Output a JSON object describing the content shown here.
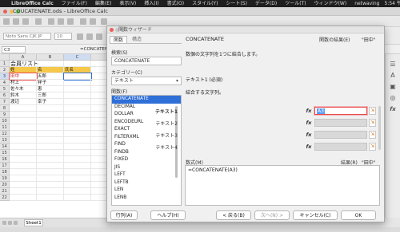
{
  "menubar": {
    "app": "LibreOffice Calc",
    "items": [
      "ファイル(F)",
      "編集(E)",
      "表示(V)",
      "挿入(I)",
      "書式(O)",
      "スタイル(Y)",
      "シート(S)",
      "データ(D)",
      "ツール(T)",
      "ウィンドウ(W)"
    ],
    "right_user": "netwaving",
    "right_time": "5:54 午後"
  },
  "window": {
    "title": "COUCATENATE.ods - LibreOffice Calc"
  },
  "toolbar": {
    "font_name": "Noto Sans CJK JP",
    "font_size": "10"
  },
  "formula_bar": {
    "name_box": "C3",
    "content": "=CONCATENATE(A3)"
  },
  "sheet": {
    "columns": [
      "A",
      "B",
      "C"
    ],
    "rows": [
      {
        "num": "1",
        "a": "会員リスト",
        "b": "",
        "c": ""
      },
      {
        "num": "2",
        "a": "姓",
        "b": "名",
        "c": "氏名"
      },
      {
        "num": "3",
        "a": "田中",
        "b": "五郎",
        "c": ""
      },
      {
        "num": "4",
        "a": "村上",
        "b": "祥子",
        "c": ""
      },
      {
        "num": "5",
        "a": "佐々木",
        "b": "恵",
        "c": ""
      },
      {
        "num": "6",
        "a": "鈴木",
        "b": "三郎",
        "c": ""
      },
      {
        "num": "7",
        "a": "渡辺",
        "b": "幸子",
        "c": ""
      },
      {
        "num": "8",
        "a": "",
        "b": "",
        "c": ""
      },
      {
        "num": "9",
        "a": "",
        "b": "",
        "c": ""
      },
      {
        "num": "10",
        "a": "",
        "b": "",
        "c": ""
      },
      {
        "num": "11",
        "a": "",
        "b": "",
        "c": ""
      },
      {
        "num": "12",
        "a": "",
        "b": "",
        "c": ""
      },
      {
        "num": "13",
        "a": "",
        "b": "",
        "c": ""
      },
      {
        "num": "14",
        "a": "",
        "b": "",
        "c": ""
      },
      {
        "num": "15",
        "a": "",
        "b": "",
        "c": ""
      },
      {
        "num": "16",
        "a": "",
        "b": "",
        "c": ""
      },
      {
        "num": "17",
        "a": "",
        "b": "",
        "c": ""
      },
      {
        "num": "18",
        "a": "",
        "b": "",
        "c": ""
      },
      {
        "num": "19",
        "a": "",
        "b": "",
        "c": ""
      },
      {
        "num": "20",
        "a": "",
        "b": "",
        "c": ""
      },
      {
        "num": "21",
        "a": "",
        "b": "",
        "c": ""
      },
      {
        "num": "22",
        "a": "",
        "b": "",
        "c": ""
      }
    ],
    "tab": "Sheet1"
  },
  "wizard": {
    "title": "関数ウィザード",
    "tabs": {
      "functions": "関数",
      "structure": "構造"
    },
    "search_label": "検索(S)",
    "search_value": "CONCATENATE",
    "category_label": "カテゴリー(C)",
    "category_value": "テキスト",
    "function_label": "関数(F)",
    "functions": [
      "CONCATENATE",
      "DECIMAL",
      "DOLLAR",
      "ENCODEURL",
      "EXACT",
      "FILTERXML",
      "FIND",
      "FINDB",
      "FIXED",
      "JIS",
      "LEFT",
      "LEFTB",
      "LEN",
      "LENB"
    ],
    "selected_function": "CONCATENATE",
    "fn_name": "CONCATENATE",
    "result_label": "関数の結果(E)",
    "result_value": "\"田中\"",
    "fn_description": "数個の文字列を1つに結合します。",
    "arg_name": "テキスト1 (必須)",
    "arg_description": "結合する文字列。",
    "args": [
      {
        "label": "テキスト1",
        "value": "A3",
        "active": true
      },
      {
        "label": "テキスト2",
        "value": "",
        "active": false
      },
      {
        "label": "テキスト3",
        "value": "",
        "active": false
      },
      {
        "label": "テキスト4",
        "value": "",
        "active": false
      }
    ],
    "fx_glyph": "fx",
    "shrink_glyph": "⇲",
    "formula_label": "数式(M)",
    "formula_value": "=CONCATENATE(A3)",
    "result2_label": "結果(R)",
    "result2_value": "\"田中\"",
    "buttons": {
      "help": "ヘルプ(H)",
      "legacy": "行列(A)",
      "back": "< 戻る(B)",
      "next": "次へ(N) >",
      "cancel": "キャンセル(C)",
      "ok": "OK"
    }
  },
  "colors": {
    "header_fill": "#f5c84a",
    "selection": "#2f6fd8",
    "active_border": "#e84b4b"
  }
}
